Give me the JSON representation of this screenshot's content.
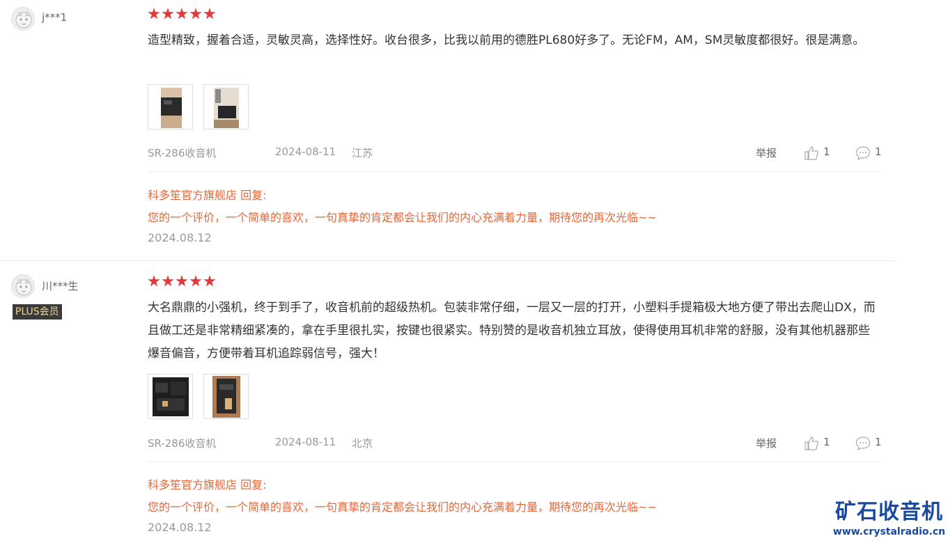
{
  "reviews": [
    {
      "username": "j***1",
      "badge": "",
      "rating": 5,
      "content": "造型精致，握着合适，灵敏灵高，选择性好。收台很多，比我以前用的德胜PL680好多了。无论FM，AM，SM灵敏度都很好。很是满意。",
      "product": "SR-286收音机",
      "date": "2024-08-11",
      "location": "江苏",
      "report_label": "举报",
      "likes": "1",
      "comments": "1",
      "reply_header": "科多笙官方旗舰店 回复:",
      "reply_text": "您的一个评价，一个简单的喜欢，一句真挚的肯定都会让我们的内心充满着力量，期待您的再次光临~~",
      "reply_date": "2024.08.12"
    },
    {
      "username": "川***生",
      "badge": "PLUS会员",
      "rating": 5,
      "content": "大名鼎鼎的小强机，终于到手了，收音机前的超级热机。包装非常仔细，一层又一层的打开，小塑料手提箱极大地方便了带出去爬山DX，而且做工还是非常精细紧凑的，拿在手里很扎实，按键也很紧实。特别赞的是收音机独立耳放，使得使用耳机非常的舒服，没有其他机器那些爆音偏音，方便带着耳机追踪弱信号，强大！",
      "product": "SR-286收音机",
      "date": "2024-08-11",
      "location": "北京",
      "report_label": "举报",
      "likes": "1",
      "comments": "1",
      "reply_header": "科多笙官方旗舰店 回复:",
      "reply_text": "您的一个评价，一个简单的喜欢，一句真挚的肯定都会让我们的内心充满着力量，期待您的再次光临~~",
      "reply_date": "2024.08.12"
    }
  ],
  "icons": {
    "star": "star-icon",
    "like": "thumbs-up-icon",
    "comment": "comment-bubble-icon"
  },
  "colors": {
    "star": "#e4393c",
    "reply": "#e4673a",
    "muted": "#999999",
    "badge_bg": "#3a3a3a",
    "badge_text": "#f5d98a",
    "watermark": "#1a4aa0"
  },
  "watermark": {
    "title": "矿石收音机",
    "url": "www.crystalradio.cn"
  }
}
